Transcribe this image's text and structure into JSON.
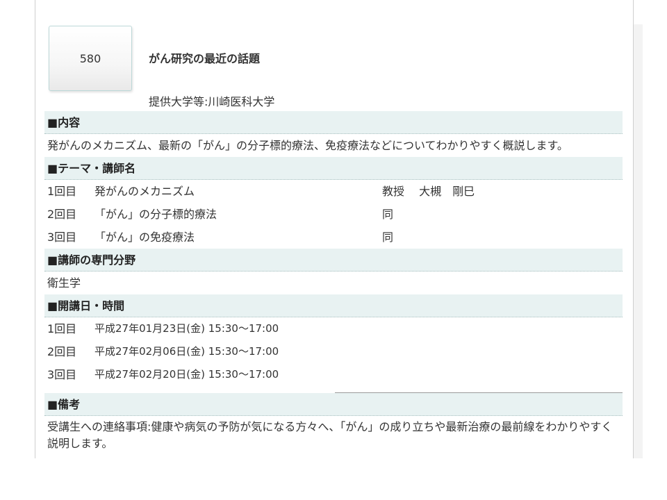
{
  "course": {
    "number": "580",
    "title": "がん研究の最近の話題",
    "provider": "提供大学等:川崎医科大学"
  },
  "sections": {
    "content": {
      "header": "■内容",
      "body": "発がんのメカニズム、最新の「がん」の分子標的療法、免疫療法などについてわかりやすく概説します。"
    },
    "themes": {
      "header": "■テーマ・講師名",
      "rows": [
        {
          "num": "1回目",
          "theme": "発がんのメカニズム",
          "lecturer": "教授　 大槻　剛巳"
        },
        {
          "num": "2回目",
          "theme": "「がん」の分子標的療法",
          "lecturer": "同"
        },
        {
          "num": "3回目",
          "theme": "「がん」の免疫療法",
          "lecturer": "同"
        }
      ]
    },
    "specialty": {
      "header": "■講師の専門分野",
      "body": "衛生学"
    },
    "schedule": {
      "header": "■開講日・時間",
      "rows": [
        {
          "num": "1回目",
          "date": "平成27年01月23日(金) 15:30〜17:00"
        },
        {
          "num": "2回目",
          "date": "平成27年02月06日(金) 15:30〜17:00"
        },
        {
          "num": "3回目",
          "date": "平成27年02月20日(金) 15:30〜17:00"
        }
      ]
    },
    "remarks": {
      "header": "■備考",
      "body": "受講生への連絡事項:健康や病気の予防が気になる方々へ、「がん」の成り立ちや最新治療の最前線をわかりやすく説明します。"
    }
  }
}
